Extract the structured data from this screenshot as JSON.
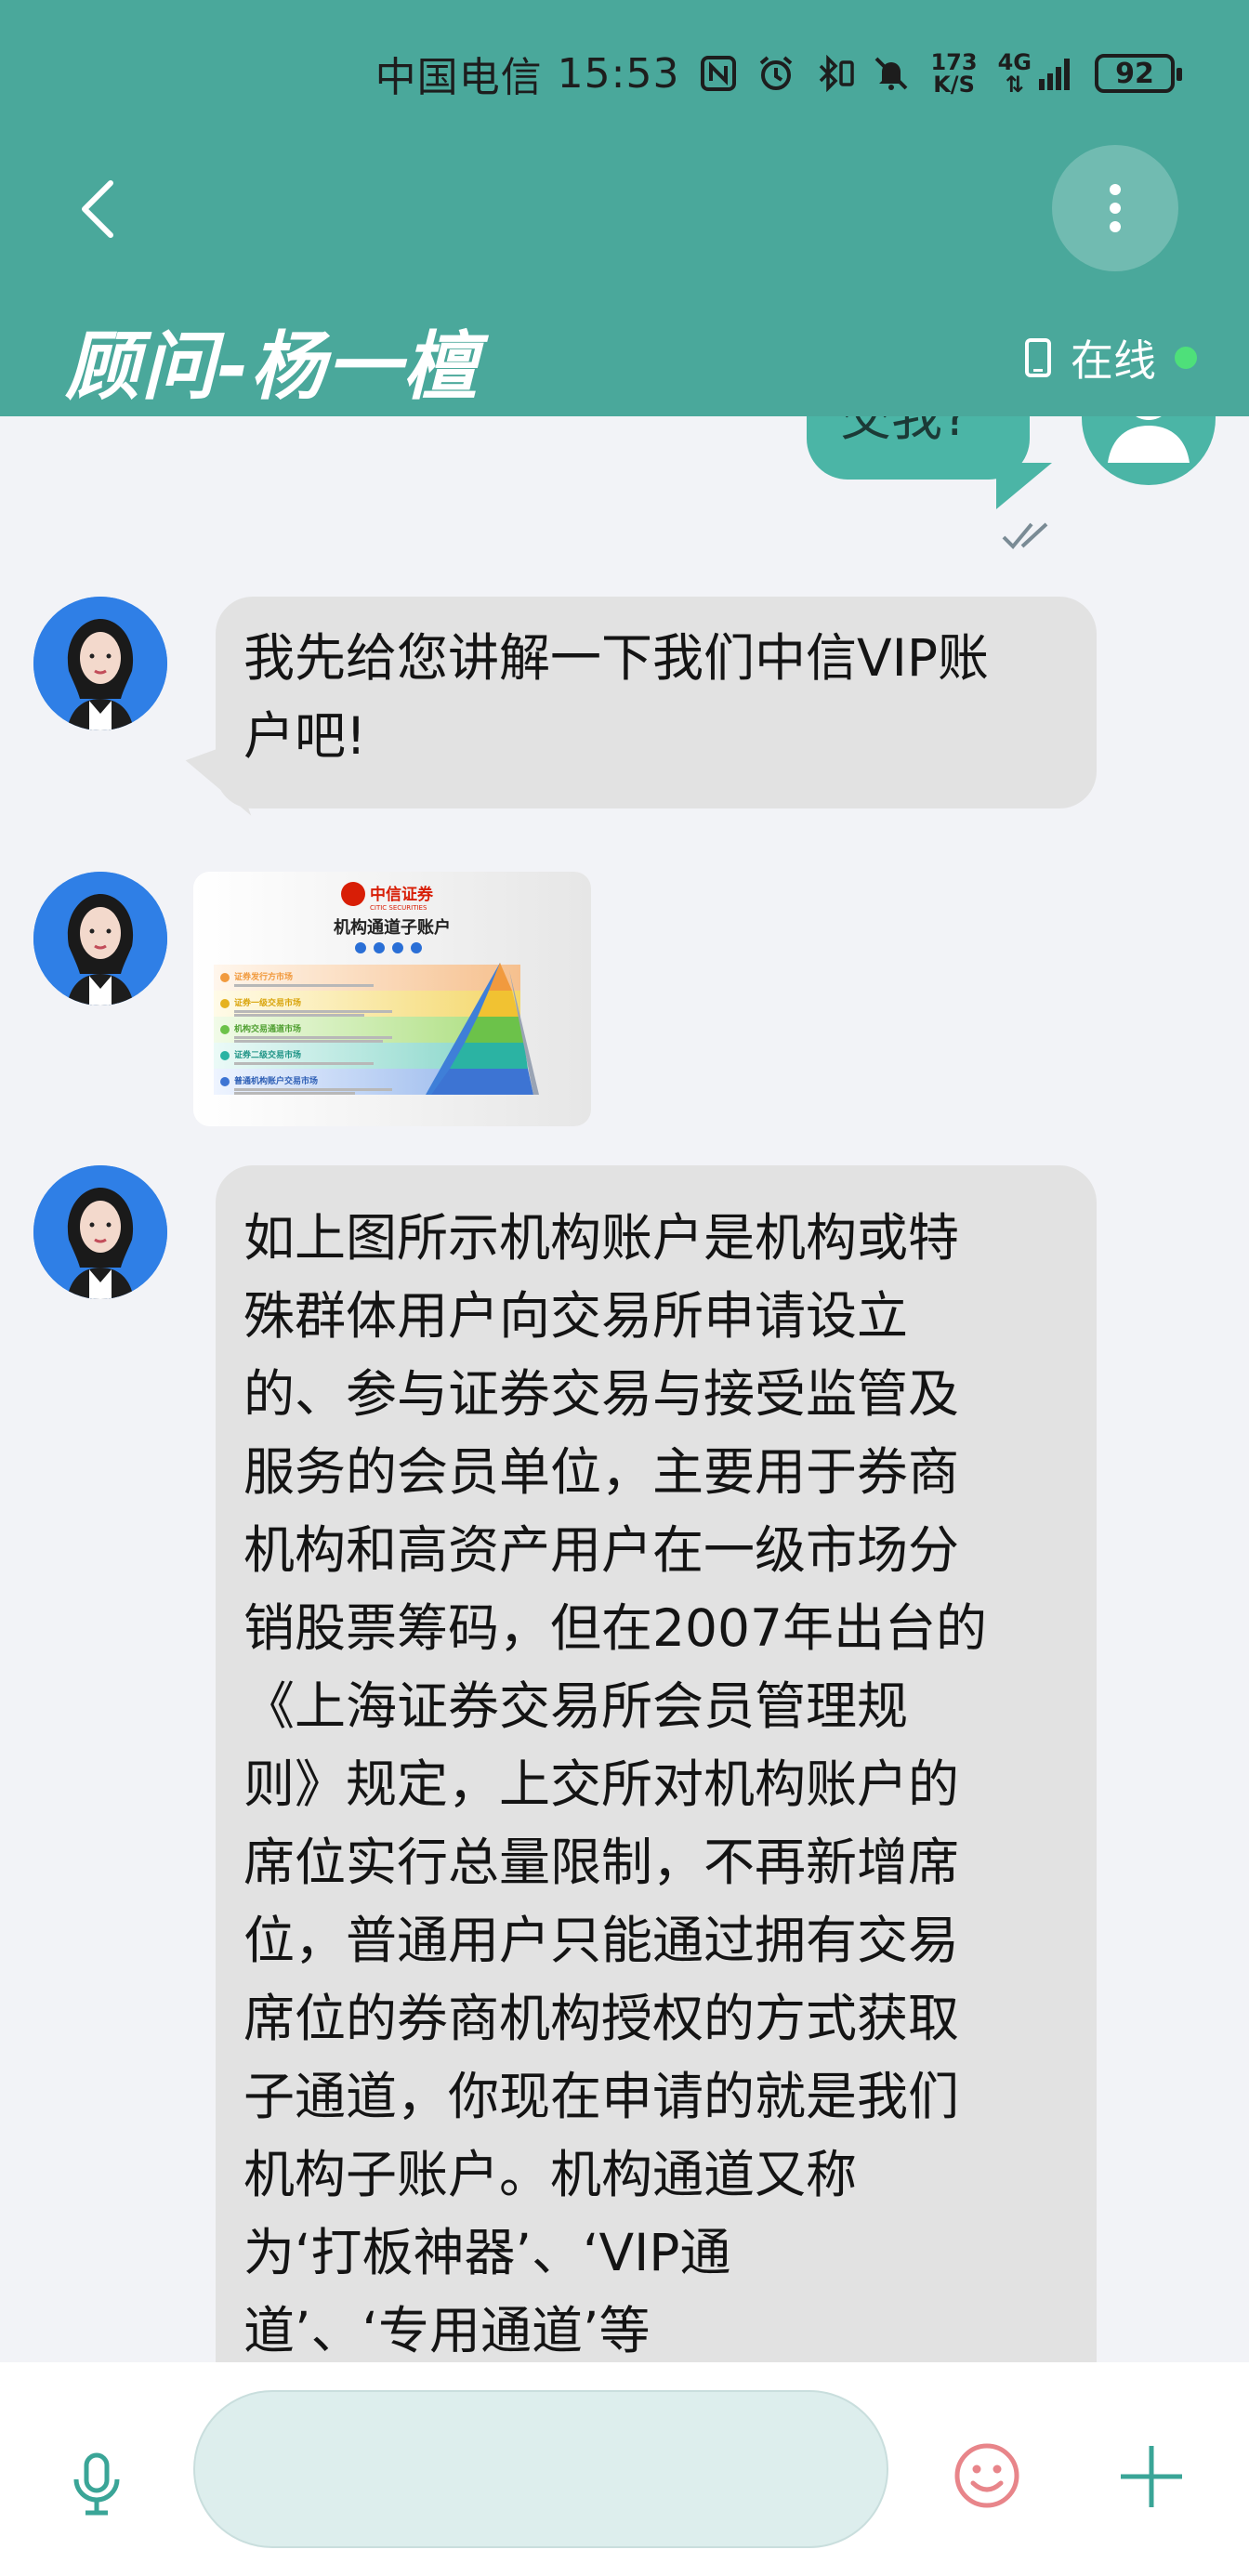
{
  "status_bar": {
    "carrier": "中国电信",
    "time": "15:53",
    "net_speed_top": "173",
    "net_speed_bottom": "K/S",
    "network": "4G",
    "battery": "92"
  },
  "header": {
    "title": "顾问-杨一檀",
    "status": "在线"
  },
  "messages": {
    "sent_partial": "交我?",
    "msg1": "我先给您讲解一下我们中信VIP账户吧!",
    "msg1_lines": [
      "我先给您讲解一下我们中信VIP账",
      "户吧!"
    ],
    "image": {
      "brand": "中信证券",
      "brand_en": "CITIC SECURITIES",
      "title": "机构通道子账户",
      "tiers": [
        "证券发行方市场",
        "证券一级交易市场",
        "机构交易通道市场",
        "证券二级交易市场",
        "普通机构账户交易市场"
      ]
    },
    "msg3_lines": [
      "如上图所示机构账户是机构或特",
      "殊群体用户向交易所申请设立",
      "的、参与证券交易与接受监管及",
      "服务的会员单位，主要用于券商",
      "机构和高资产用户在一级市场分",
      "销股票筹码，但在2007年出台的",
      "《上海证券交易所会员管理规",
      "则》规定，上交所对机构账户的",
      "席位实行总量限制，不再新增席",
      "位，普通用户只能通过拥有交易",
      "席位的券商机构授权的方式获取",
      "子通道，你现在申请的就是我们",
      "机构子账户。机构通道又称",
      "为‘打板神器’、‘VIP通",
      "道’、‘专用通道’等"
    ]
  },
  "colors": {
    "header_bg": "#4aa89b",
    "sent_bubble": "#4bb5a6",
    "received_bubble": "#e2e2e2",
    "online_dot": "#4ee07a",
    "emoji_icon": "#e8858a"
  }
}
